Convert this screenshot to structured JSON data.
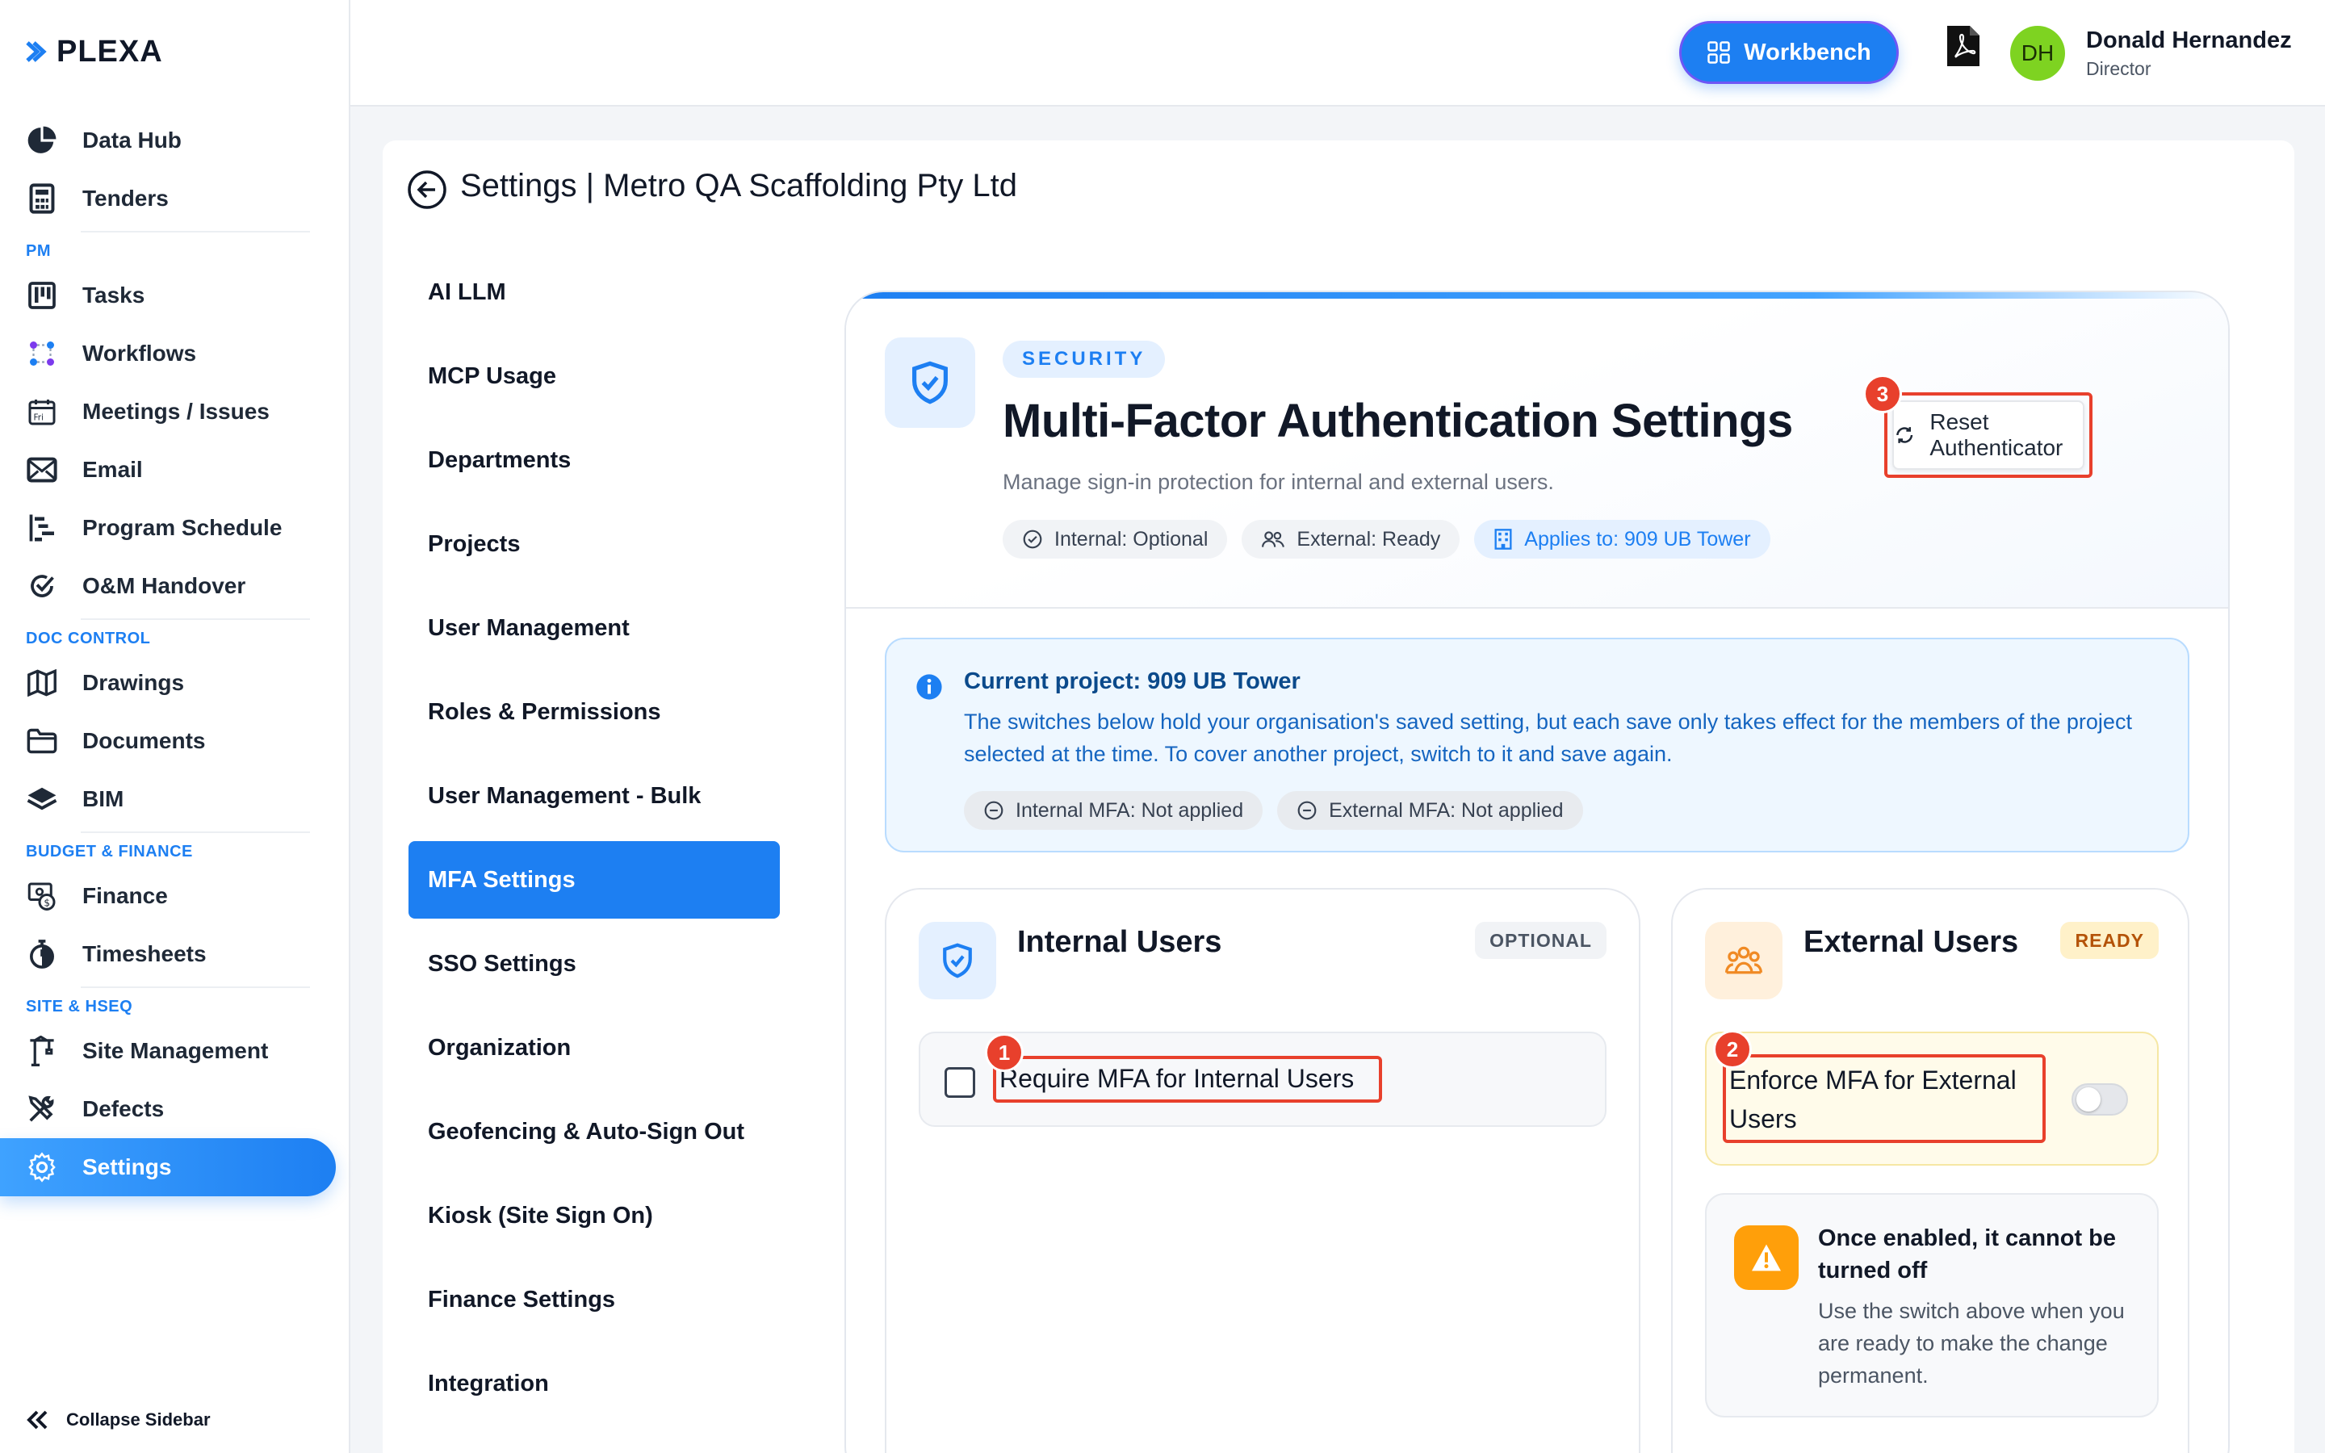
{
  "brand": {
    "name": "PLEXA"
  },
  "sidebar": {
    "items_top": [
      {
        "label": "Data Hub",
        "icon": "pie-chart-icon"
      },
      {
        "label": "Tenders",
        "icon": "calculator-icon"
      }
    ],
    "sections": [
      {
        "title": "PM",
        "items": [
          {
            "label": "Tasks",
            "icon": "kanban-icon"
          },
          {
            "label": "Workflows",
            "icon": "workflow-icon"
          },
          {
            "label": "Meetings / Issues",
            "icon": "calendar-icon"
          },
          {
            "label": "Email",
            "icon": "mail-icon"
          },
          {
            "label": "Program Schedule",
            "icon": "gantt-icon"
          },
          {
            "label": "O&M Handover",
            "icon": "check-circle-icon"
          }
        ]
      },
      {
        "title": "DOC CONTROL",
        "items": [
          {
            "label": "Drawings",
            "icon": "map-icon"
          },
          {
            "label": "Documents",
            "icon": "folder-icon"
          },
          {
            "label": "BIM",
            "icon": "layers-icon"
          }
        ]
      },
      {
        "title": "BUDGET & FINANCE",
        "items": [
          {
            "label": "Finance",
            "icon": "finance-icon"
          },
          {
            "label": "Timesheets",
            "icon": "stopwatch-icon"
          }
        ]
      },
      {
        "title": "SITE & HSEQ",
        "items": [
          {
            "label": "Site Management",
            "icon": "crane-icon"
          },
          {
            "label": "Defects",
            "icon": "tools-icon"
          },
          {
            "label": "Settings",
            "icon": "gear-icon",
            "active": true
          }
        ]
      }
    ],
    "collapse_label": "Collapse Sidebar"
  },
  "header": {
    "workbench_label": "Workbench",
    "user": {
      "initials": "DH",
      "name": "Donald Hernandez",
      "role": "Director"
    }
  },
  "page": {
    "title": "Settings | Metro QA Scaffolding Pty Ltd"
  },
  "settings_menu": [
    "AI LLM",
    "MCP Usage",
    "Departments",
    "Projects",
    "User Management",
    "Roles & Permissions",
    "User Management - Bulk",
    "MFA Settings",
    "SSO Settings",
    "Organization",
    "Geofencing & Auto-Sign Out",
    "Kiosk (Site Sign On)",
    "Finance Settings",
    "Integration"
  ],
  "settings_menu_active": "MFA Settings",
  "mfa": {
    "category": "SECURITY",
    "title": "Multi-Factor Authentication Settings",
    "subtitle": "Manage sign-in protection for internal and external users.",
    "chips": {
      "internal": "Internal: Optional",
      "external": "External: Ready",
      "applies": "Applies to: 909 UB Tower"
    },
    "reset_label": "Reset Authenticator",
    "reset_badge": "3",
    "info": {
      "title": "Current project: 909 UB Tower",
      "text": "The switches below hold your organisation's saved setting, but each save only takes effect for the members of the project selected at the time. To cover another project, switch to it and save again.",
      "internal_chip": "Internal MFA: Not applied",
      "external_chip": "External MFA: Not applied"
    },
    "internal": {
      "title": "Internal Users",
      "status": "OPTIONAL",
      "toggle_label": "Require MFA for Internal Users",
      "badge": "1",
      "checked": false
    },
    "external": {
      "title": "External Users",
      "status": "READY",
      "toggle_label_line1": "Enforce MFA for External",
      "toggle_label_line2": "Users",
      "badge": "2",
      "enabled": false,
      "warning_title": "Once enabled, it cannot be turned off",
      "warning_text": "Use the switch above when you are ready to make the change permanent."
    }
  },
  "colors": {
    "accent": "#1d7ff2",
    "highlight": "#e8402c",
    "warning": "#ff9f0a"
  }
}
